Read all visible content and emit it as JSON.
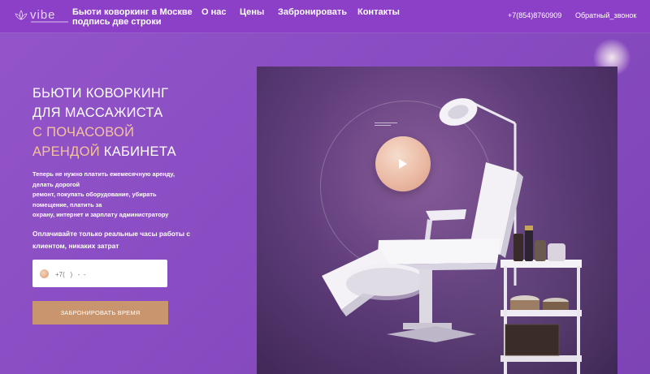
{
  "header": {
    "logo_text": "vibe",
    "brand_title": "Бьюти коворкинг в Москве подпись две строки",
    "nav": [
      "О нас",
      "Цены",
      "Забронировать",
      "Контакты"
    ],
    "phone": "+7(854)8760909",
    "callback": "Обратный_звонок"
  },
  "hero": {
    "title_lines": [
      "БЬЮТИ КОВОРКИНГ",
      "ДЛЯ МАССАЖИСТА",
      "С ПОЧАСОВОЙ",
      "АРЕНДОЙ"
    ],
    "title_tail": "КАБИНЕТА",
    "description_lines": [
      "Теперь не нужно платить ежемесячную аренду,",
      "делать дорогой",
      "ремонт, покупать оборудование, убирать",
      "помещение, платить за",
      "охрану, интернет и зарплату администратору"
    ],
    "subtitle": "Оплачивайте только реальные часы работы с клиентом, никаких затрат",
    "phone_placeholder": "+7(   )   -  -",
    "book_button": "ЗАБРОНИРОВАТЬ ВРЕМЯ"
  },
  "media": {
    "play_icon": "play-icon",
    "logo_icon": "lotus-icon"
  },
  "colors": {
    "header_bg": "#8c3fc7",
    "page_bg": "#9355c9",
    "accent": "#f4c39c",
    "button": "#c9956e"
  }
}
